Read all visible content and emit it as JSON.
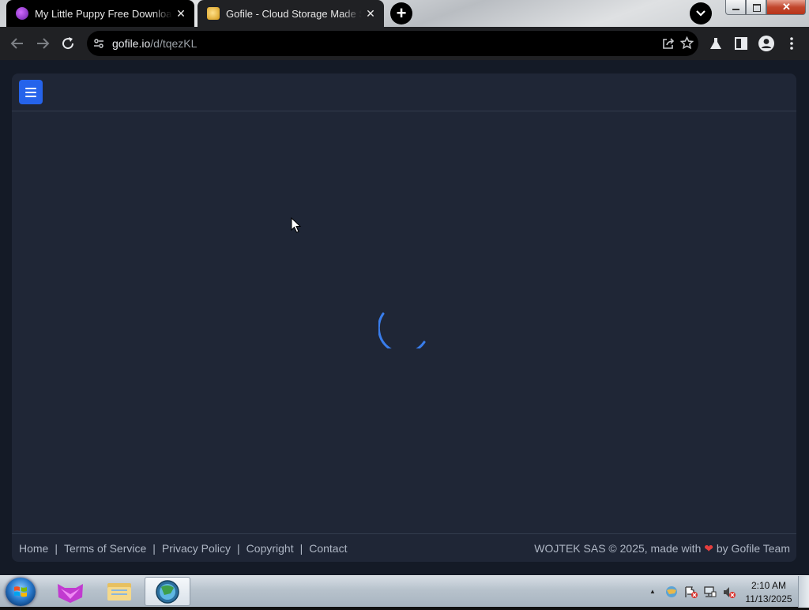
{
  "browser": {
    "tabs": [
      {
        "title": "My Little Puppy Free Download",
        "active": false,
        "favicon": "purple-app-icon"
      },
      {
        "title": "Gofile - Cloud Storage Made Simple",
        "active": true,
        "favicon": "gofile-icon"
      }
    ],
    "close_glyph": "✕",
    "new_tab_glyph": "+",
    "url_host": "gofile.io",
    "url_path": "/d/tqezKL"
  },
  "page": {
    "footer_links": [
      "Home",
      "Terms of Service",
      "Privacy Policy",
      "Copyright",
      "Contact"
    ],
    "separator": "|",
    "credit_prefix": "WOJTEK SAS © 2025, made with",
    "credit_heart": "❤",
    "credit_suffix": "by Gofile Team",
    "accent_color": "#2563eb",
    "spinner_color": "#3b82f6"
  },
  "taskbar": {
    "time": "2:10 AM",
    "date": "11/13/2025",
    "tray_up_glyph": "▲"
  }
}
